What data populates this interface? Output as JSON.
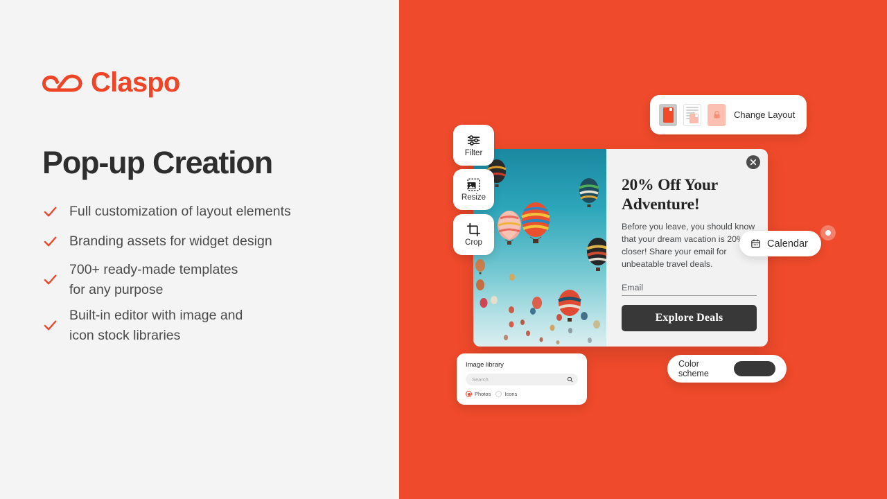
{
  "brand": {
    "name": "Claspo",
    "accent": "#EF4526",
    "logo_icon": "cloud-swoosh-icon"
  },
  "left": {
    "headline": "Pop-up Creation",
    "features": [
      {
        "text": "Full customization of layout elements",
        "icon": "check-icon"
      },
      {
        "text": "Branding assets for widget design",
        "icon": "check-icon"
      },
      {
        "text": "700+ ready-made templates\nfor any purpose",
        "icon": "check-icon"
      },
      {
        "text": "Built-in editor with image and\nicon stock libraries",
        "icon": "check-icon"
      }
    ]
  },
  "right": {
    "background_color": "#EF4A2B",
    "tools": [
      {
        "label": "Filter",
        "icon": "sliders-icon"
      },
      {
        "label": "Resize",
        "icon": "image-resize-icon"
      },
      {
        "label": "Crop",
        "icon": "crop-icon"
      }
    ],
    "layout_card": {
      "label": "Change Layout",
      "thumbnails": [
        "layout-thumb-image-only",
        "layout-thumb-text-image",
        "layout-thumb-locked"
      ]
    },
    "popup": {
      "close_icon": "close-icon",
      "title": "20% Off Your Adventure!",
      "body": "Before you leave, you should know that your dream vacation is 20% closer! Share your email for unbeatable travel deals.",
      "field_label": "Email",
      "field_value": "",
      "cta_label": "Explore Deals",
      "cta_color": "#383838",
      "image_alt": "hot-air-balloons-photo"
    },
    "calendar_chip": {
      "label": "Calendar",
      "icon": "calendar-icon"
    },
    "image_library": {
      "title": "Image library",
      "search_placeholder": "Search",
      "search_value": "",
      "search_icon": "search-icon",
      "options": [
        {
          "label": "Photos",
          "selected": true
        },
        {
          "label": "Icons",
          "selected": false
        }
      ]
    },
    "color_scheme": {
      "label": "Color scheme",
      "swatch_color": "#383838"
    }
  }
}
